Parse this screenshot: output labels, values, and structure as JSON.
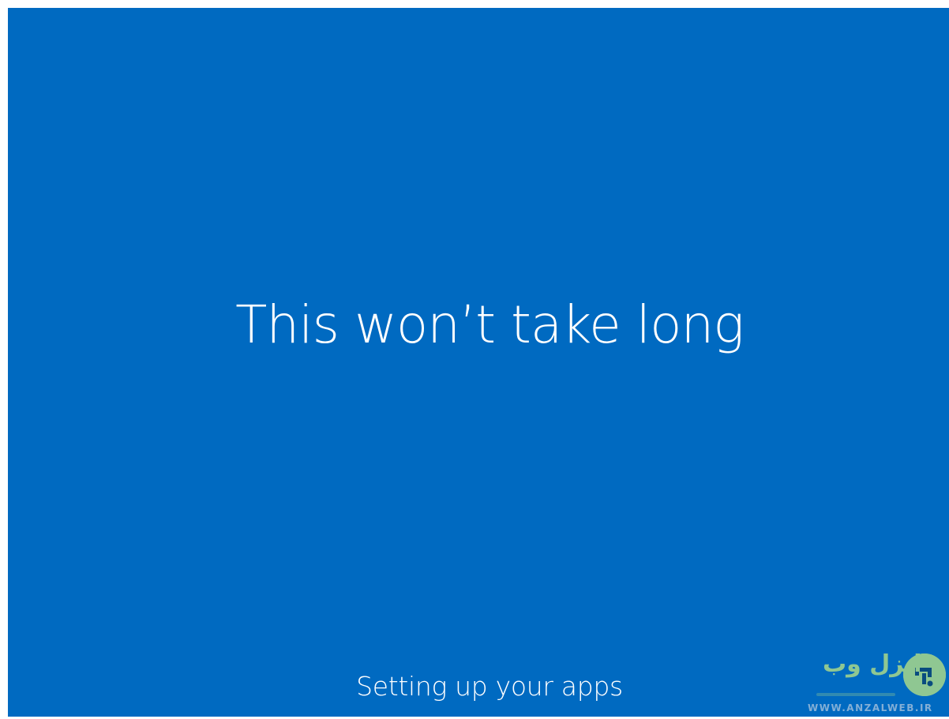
{
  "screen": {
    "headline": "This won’t take long",
    "status": "Setting up your apps",
    "background_color": "#006ac1"
  },
  "watermark": {
    "name": "انزل وب",
    "url": "WWW.ANZALWEB.IR",
    "brand_color": "#9ccf8f"
  }
}
